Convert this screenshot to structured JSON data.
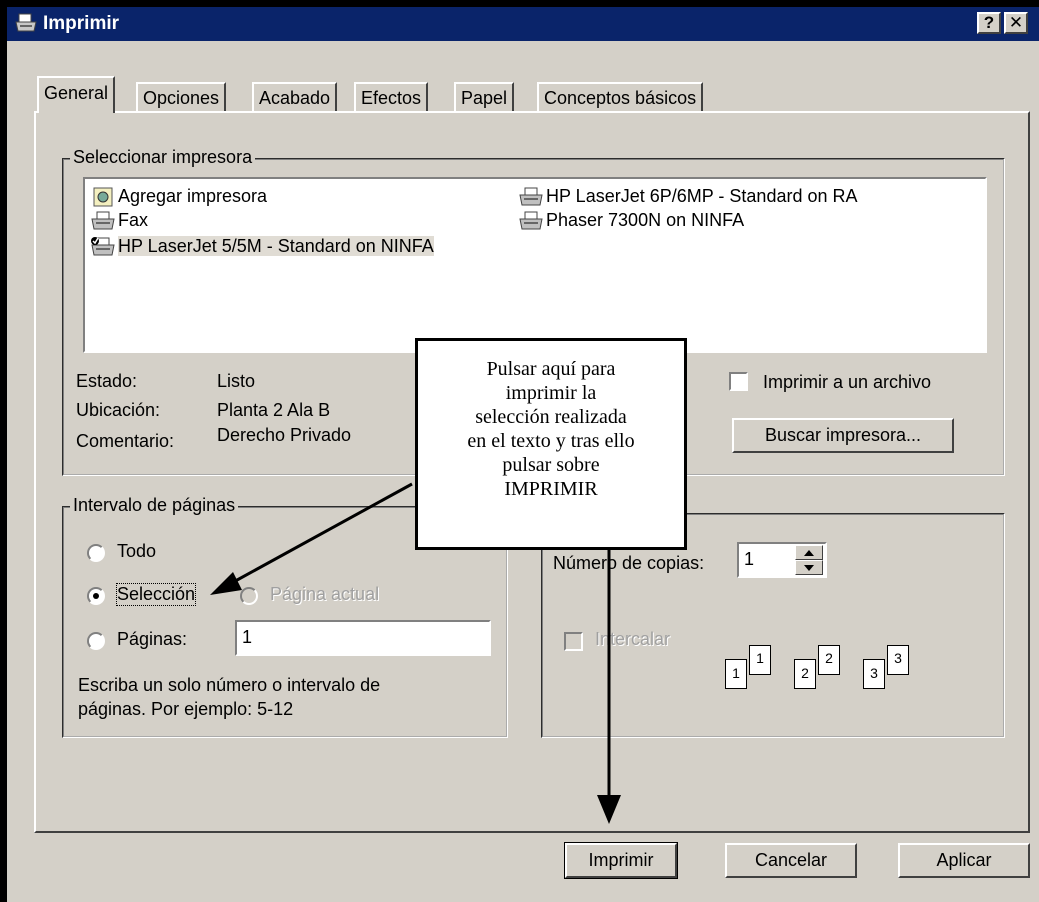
{
  "window": {
    "title": "Imprimir",
    "help_button": "?",
    "close_button": "✕"
  },
  "tabs": [
    {
      "label": "General",
      "active": true
    },
    {
      "label": "Opciones"
    },
    {
      "label": "Acabado"
    },
    {
      "label": "Efectos"
    },
    {
      "label": "Papel"
    },
    {
      "label": "Conceptos básicos"
    }
  ],
  "select_printer": {
    "legend": "Seleccionar impresora",
    "printers": [
      {
        "name": "Agregar impresora",
        "icon": "add-printer-icon"
      },
      {
        "name": "Fax",
        "icon": "printer-icon"
      },
      {
        "name": "HP LaserJet 5/5M - Standard on NINFA",
        "icon": "default-printer-icon",
        "selected": true
      },
      {
        "name": "HP LaserJet 6P/6MP - Standard on RA",
        "icon": "printer-icon"
      },
      {
        "name": "Phaser 7300N on NINFA",
        "icon": "printer-icon"
      }
    ],
    "status_label": "Estado:",
    "status_value": "Listo",
    "location_label": "Ubicación:",
    "location_value": "Planta 2 Ala B",
    "comment_label": "Comentario:",
    "comment_value": "Derecho Privado",
    "print_to_file_label": "Imprimir a un archivo",
    "find_printer_label": "Buscar impresora..."
  },
  "page_range": {
    "legend": "Intervalo de páginas",
    "all_label": "Todo",
    "selection_label": "Selección",
    "current_page_label": "Página actual",
    "pages_label": "Páginas:",
    "pages_value": "1",
    "help_text_line1": "Escriba un solo número o intervalo de",
    "help_text_line2": "páginas. Por ejemplo: 5-12",
    "selected_option": "Selección"
  },
  "copies": {
    "label": "Número de copias:",
    "value": "1",
    "collate_label": "Intercalar",
    "page_labels": [
      "1",
      "1",
      "2",
      "2",
      "3",
      "3"
    ]
  },
  "callout": {
    "lines": [
      "Pulsar aquí para",
      "imprimir la",
      "selección realizada",
      "en el texto y tras ello",
      "pulsar sobre",
      "IMPRIMIR"
    ]
  },
  "buttons": {
    "print": "Imprimir",
    "cancel": "Cancelar",
    "apply": "Aplicar"
  },
  "colors": {
    "title_bar": "#0a246a",
    "dialog_face": "#d4d0c8"
  }
}
